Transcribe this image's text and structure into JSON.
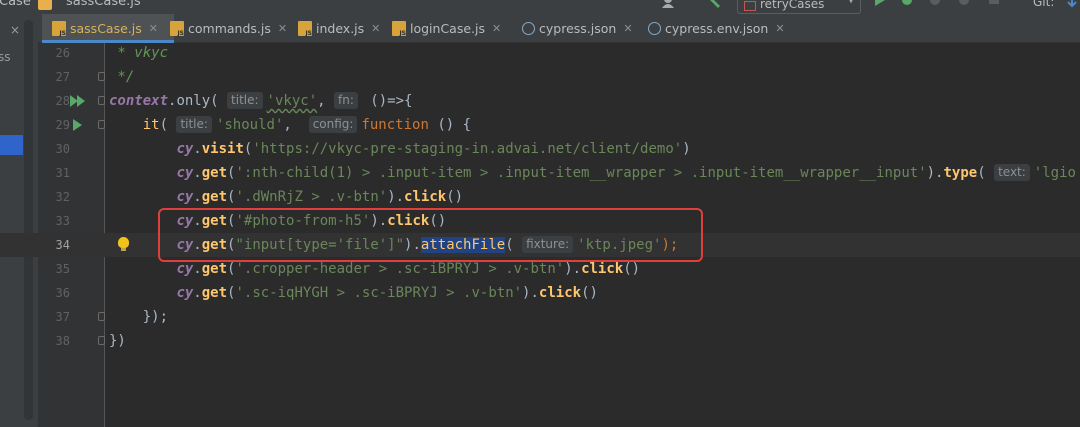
{
  "toolbar": {
    "breadcrumb_project": "Case",
    "breadcrumb_file": "sassCase.js",
    "run_config": "retryCases",
    "git_label": "Git:"
  },
  "tabs": [
    {
      "label": "sassCase.js",
      "icon": "js-file-icon",
      "active": true
    },
    {
      "label": "commands.js",
      "icon": "js-file-icon",
      "active": false
    },
    {
      "label": "index.js",
      "icon": "js-file-icon",
      "active": false
    },
    {
      "label": "loginCase.js",
      "icon": "js-file-icon",
      "active": false
    },
    {
      "label": "cypress.json",
      "icon": "json-file-icon",
      "active": false
    },
    {
      "label": "cypress.env.json",
      "icon": "json-file-icon",
      "active": false
    }
  ],
  "sidepanel": {
    "close_glyph": "×",
    "label_fragment": "ss"
  },
  "editor": {
    "line_numbers": [
      "26",
      "27",
      "28",
      "29",
      "30",
      "31",
      "32",
      "33",
      "34",
      "35",
      "36",
      "37",
      "38"
    ],
    "line26_comment": " * vkyc",
    "line27_comment": " */",
    "line28": {
      "ctx": "context",
      "only": "only",
      "hint_title": "title:",
      "arg1": "'vkyc'",
      "hint_fn": "fn:",
      "tail": " ()=>{"
    },
    "line29": {
      "it": "it",
      "hint_title": "title:",
      "arg1": "'should'",
      "hint_config": "config:",
      "kw": "function",
      "tail": " () {"
    },
    "line30": {
      "obj": "cy",
      "method": "visit",
      "url": "'https://vkyc-pre-staging-in.advai.net/client/demo'"
    },
    "line31": {
      "obj": "cy",
      "method": "get",
      "sel": "':nth-child(1) > .input-item > .input-item__wrapper > .input-item__wrapper__input'",
      "method2": "type",
      "hint_text": "text:",
      "arg": "'lgio"
    },
    "line32": {
      "obj": "cy",
      "method": "get",
      "sel": "'.dWnRjZ > .v-btn'",
      "method2": "click"
    },
    "line33": {
      "obj": "cy",
      "method": "get",
      "sel": "'#photo-from-h5'",
      "method2": "click"
    },
    "line34": {
      "obj": "cy",
      "method": "get",
      "sel": "\"input[type='file']\"",
      "method2": "attachFile",
      "hint_fixture": "fixture:",
      "arg": "'ktp.jpeg'"
    },
    "line35": {
      "obj": "cy",
      "method": "get",
      "sel": "'.cropper-header > .sc-iBPRYJ > .v-btn'",
      "method2": "click"
    },
    "line36": {
      "obj": "cy",
      "method": "get",
      "sel": "'.sc-iqHYGH > .sc-iBPRYJ > .v-btn'",
      "method2": "click"
    },
    "line37": "});",
    "line38": "})"
  }
}
